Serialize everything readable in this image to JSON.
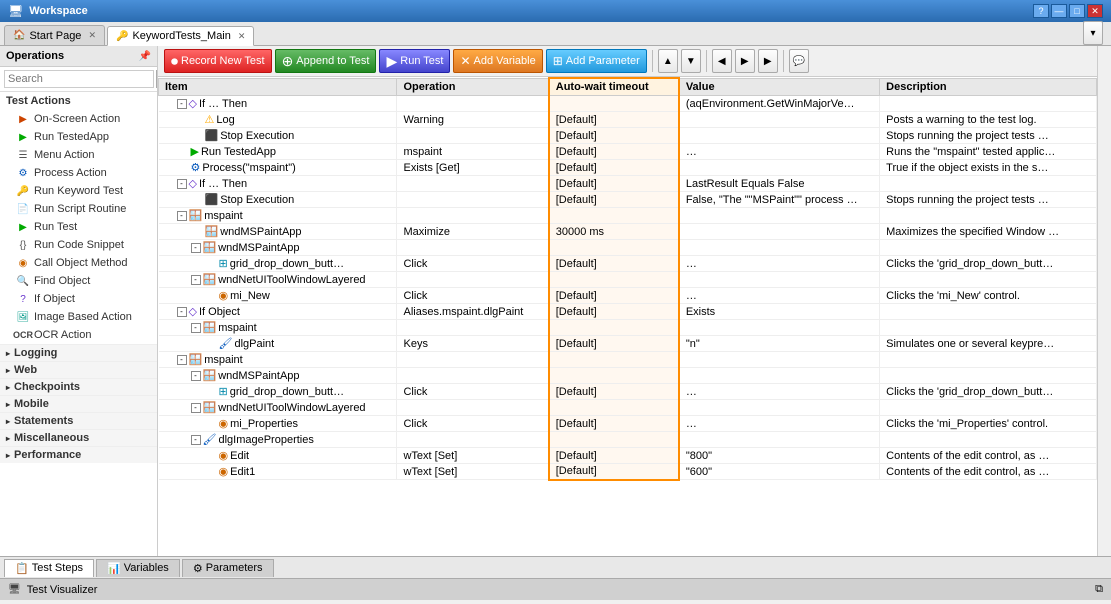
{
  "titleBar": {
    "title": "Workspace",
    "buttons": [
      "?",
      "—",
      "□",
      "✕"
    ]
  },
  "tabs": [
    {
      "label": "Start Page",
      "icon": "🏠",
      "active": false
    },
    {
      "label": "KeywordTests_Main",
      "icon": "🔑",
      "active": true
    }
  ],
  "sidebar": {
    "header": "Operations",
    "searchPlaceholder": "Search",
    "sections": [
      {
        "name": "Test Actions",
        "items": [
          {
            "label": "On-Screen Action",
            "icon": "▶"
          },
          {
            "label": "Run TestedApp",
            "icon": "▶"
          },
          {
            "label": "Menu Action",
            "icon": "☰"
          },
          {
            "label": "Process Action",
            "icon": "⚙"
          },
          {
            "label": "Run Keyword Test",
            "icon": "🔑"
          },
          {
            "label": "Run Script Routine",
            "icon": "📄"
          },
          {
            "label": "Run Test",
            "icon": "▶"
          },
          {
            "label": "Run Code Snippet",
            "icon": "{ }"
          },
          {
            "label": "Call Object Method",
            "icon": "◉"
          },
          {
            "label": "Find Object",
            "icon": "🔍"
          },
          {
            "label": "If Object",
            "icon": "?"
          },
          {
            "label": "Image Based Action",
            "icon": "🖼"
          },
          {
            "label": "OCR Action",
            "icon": "T"
          }
        ]
      },
      {
        "name": "Logging",
        "items": []
      },
      {
        "name": "Web",
        "items": []
      },
      {
        "name": "Checkpoints",
        "items": []
      },
      {
        "name": "Mobile",
        "items": []
      },
      {
        "name": "Statements",
        "items": []
      },
      {
        "name": "Miscellaneous",
        "items": []
      },
      {
        "name": "Performance",
        "items": []
      }
    ]
  },
  "toolbar": {
    "recordLabel": "Record New Test",
    "appendLabel": "Append to Test",
    "runLabel": "Run Test",
    "addVarLabel": "Add Variable",
    "addParamLabel": "Add Parameter"
  },
  "table": {
    "columns": [
      "Item",
      "Operation",
      "Auto-wait timeout",
      "Value",
      "Description"
    ],
    "rows": [
      {
        "indent": 1,
        "expand": "-",
        "icon": "if",
        "item": "If … Then",
        "operation": "",
        "autowait": "",
        "value": "(aqEnvironment.GetWinMajorVe…",
        "description": ""
      },
      {
        "indent": 2,
        "expand": null,
        "icon": "log",
        "item": "Log",
        "operation": "Warning",
        "autowait": "[Default]",
        "value": "",
        "description": "Posts a warning to the test log."
      },
      {
        "indent": 2,
        "expand": null,
        "icon": "stop",
        "item": "Stop Execution",
        "operation": "",
        "autowait": "[Default]",
        "value": "",
        "description": "Stops running the project tests …"
      },
      {
        "indent": 1,
        "expand": null,
        "icon": "run",
        "item": "Run TestedApp",
        "operation": "mspaint",
        "autowait": "[Default]",
        "value": "…",
        "description": "Runs the \"mspaint\" tested applic…"
      },
      {
        "indent": 1,
        "expand": null,
        "icon": "process",
        "item": "Process(\"mspaint\")",
        "operation": "Exists [Get]",
        "autowait": "[Default]",
        "value": "",
        "description": "True if the object exists in the s…"
      },
      {
        "indent": 1,
        "expand": "-",
        "icon": "if",
        "item": "If … Then",
        "operation": "",
        "autowait": "[Default]",
        "value": "LastResult Equals False",
        "description": ""
      },
      {
        "indent": 2,
        "expand": null,
        "icon": "stop",
        "item": "Stop Execution",
        "operation": "",
        "autowait": "[Default]",
        "value": "False, \"The \"\"MSPaint\"\" process …",
        "description": "Stops running the project tests …"
      },
      {
        "indent": 1,
        "expand": "-",
        "icon": "window",
        "item": "mspaint",
        "operation": "",
        "autowait": "",
        "value": "",
        "description": ""
      },
      {
        "indent": 2,
        "expand": null,
        "icon": "window",
        "item": "wndMSPaintApp",
        "operation": "Maximize",
        "autowait": "30000 ms",
        "value": "",
        "description": "Maximizes the specified Window …"
      },
      {
        "indent": 2,
        "expand": "-",
        "icon": "window",
        "item": "wndMSPaintApp",
        "operation": "",
        "autowait": "",
        "value": "",
        "description": ""
      },
      {
        "indent": 3,
        "expand": null,
        "icon": "grid",
        "item": "grid_drop_down_butt…",
        "operation": "Click",
        "autowait": "[Default]",
        "value": "…",
        "description": "Clicks the 'grid_drop_down_butt…"
      },
      {
        "indent": 2,
        "expand": "-",
        "icon": "window",
        "item": "wndNetUIToolWindowLayered",
        "operation": "",
        "autowait": "",
        "value": "",
        "description": ""
      },
      {
        "indent": 3,
        "expand": null,
        "icon": "object",
        "item": "mi_New",
        "operation": "Click",
        "autowait": "[Default]",
        "value": "…",
        "description": "Clicks the 'mi_New' control."
      },
      {
        "indent": 1,
        "expand": "-",
        "icon": "if",
        "item": "If Object",
        "operation": "Aliases.mspaint.dlgPaint",
        "autowait": "[Default]",
        "value": "Exists",
        "description": ""
      },
      {
        "indent": 2,
        "expand": "-",
        "icon": "window",
        "item": "mspaint",
        "operation": "",
        "autowait": "",
        "value": "",
        "description": ""
      },
      {
        "indent": 3,
        "expand": null,
        "icon": "paint",
        "item": "dlgPaint",
        "operation": "Keys",
        "autowait": "[Default]",
        "value": "\"n\"",
        "description": "Simulates one or several keypre…"
      },
      {
        "indent": 1,
        "expand": "-",
        "icon": "window",
        "item": "mspaint",
        "operation": "",
        "autowait": "",
        "value": "",
        "description": ""
      },
      {
        "indent": 2,
        "expand": "-",
        "icon": "window",
        "item": "wndMSPaintApp",
        "operation": "",
        "autowait": "",
        "value": "",
        "description": ""
      },
      {
        "indent": 3,
        "expand": null,
        "icon": "grid",
        "item": "grid_drop_down_butt…",
        "operation": "Click",
        "autowait": "[Default]",
        "value": "…",
        "description": "Clicks the 'grid_drop_down_butt…"
      },
      {
        "indent": 2,
        "expand": "-",
        "icon": "window",
        "item": "wndNetUIToolWindowLayered",
        "operation": "",
        "autowait": "",
        "value": "",
        "description": ""
      },
      {
        "indent": 3,
        "expand": null,
        "icon": "object",
        "item": "mi_Properties",
        "operation": "Click",
        "autowait": "[Default]",
        "value": "…",
        "description": "Clicks the 'mi_Properties' control."
      },
      {
        "indent": 2,
        "expand": "-",
        "icon": "paint",
        "item": "dlgImageProperties",
        "operation": "",
        "autowait": "",
        "value": "",
        "description": ""
      },
      {
        "indent": 3,
        "expand": null,
        "icon": "object",
        "item": "Edit",
        "operation": "wText [Set]",
        "autowait": "[Default]",
        "value": "\"800\"",
        "description": "Contents of the edit control, as …"
      },
      {
        "indent": 3,
        "expand": null,
        "icon": "object",
        "item": "Edit1",
        "operation": "wText [Set]",
        "autowait": "[Default]",
        "value": "\"600\"",
        "description": "Contents of the edit control, as …"
      }
    ]
  },
  "bottomTabs": [
    {
      "label": "Test Steps",
      "icon": "📋",
      "active": true
    },
    {
      "label": "Variables",
      "icon": "📊",
      "active": false
    },
    {
      "label": "Parameters",
      "icon": "⚙",
      "active": false
    }
  ],
  "statusBar": {
    "label": "Test Visualizer"
  },
  "icons": {
    "search": "🔍",
    "pin": "📌",
    "arrow_up": "▲",
    "arrow_down": "▼",
    "arrow_left": "◀",
    "arrow_right": "▶",
    "comment": "💬"
  }
}
